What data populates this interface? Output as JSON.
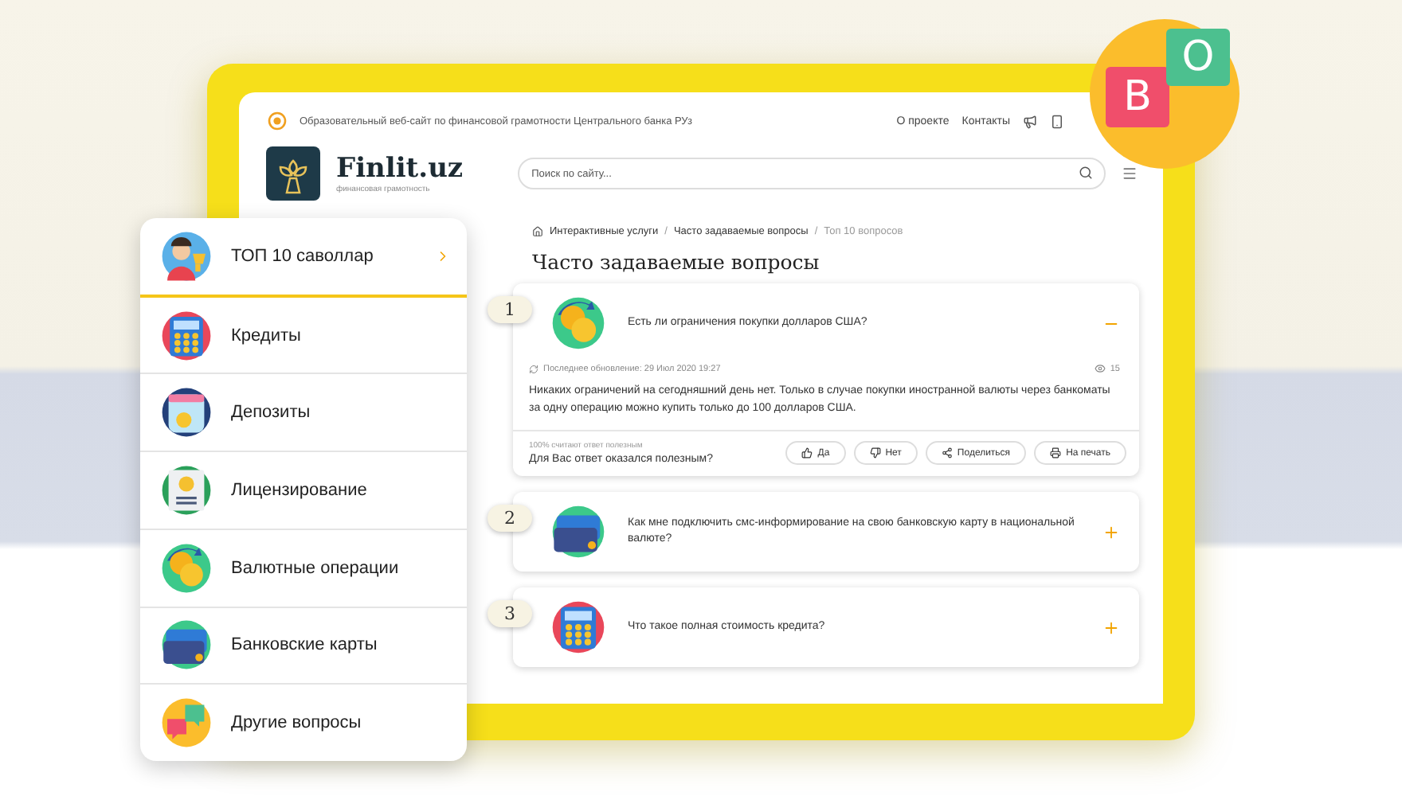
{
  "site_header": {
    "tagline": "Образовательный веб-сайт по финансовой грамотности Центрального банка РУз",
    "links": [
      "О проекте",
      "Контакты"
    ],
    "logo_name": "Finlit.uz",
    "logo_subtitle": "финансовая грамотность",
    "search": {
      "placeholder": "Поиск по сайту..."
    }
  },
  "breadcrumb_separator": "/",
  "breadcrumbs": [
    {
      "label": "Интерактивные услуги",
      "current": false
    },
    {
      "label": "Часто задаваемые вопросы",
      "current": false
    },
    {
      "label": "Топ 10 вопросов",
      "current": true
    }
  ],
  "page_title": "Часто задаваемые вопросы",
  "faq": [
    {
      "number": "1",
      "kind": "currency",
      "question": "Есть ли ограничения покупки долларов США?",
      "expanded": true,
      "updated": "Последнее обновление: 29 Июл 2020 19:27",
      "views": "15",
      "answer": "Никаких ограничений на сегодняшний день нет. Только в случае покупки иностранной валюты через банкоматы за одну операцию можно купить только до 100 долларов США.",
      "feedback_stat": "100% считают ответ полезным",
      "feedback_prompt": "Для Вас ответ оказался полезным?",
      "buttons": [
        {
          "kind": "like",
          "label": "Да"
        },
        {
          "kind": "dislike",
          "label": "Нет"
        },
        {
          "kind": "share",
          "label": "Поделиться"
        },
        {
          "kind": "print",
          "label": "На печать"
        }
      ]
    },
    {
      "number": "2",
      "kind": "card",
      "question": "Как мне подключить смс-информирование на свою банковскую карту в национальной валюте?",
      "expanded": false
    },
    {
      "number": "3",
      "kind": "calculator",
      "question": "Что такое полная стоимость кредита?",
      "expanded": false
    }
  ],
  "categories": [
    {
      "kind": "avatar",
      "label": "ТОП 10 саволлар",
      "selected": true
    },
    {
      "kind": "calculator",
      "label": "Кредиты",
      "selected": false
    },
    {
      "kind": "jar",
      "label": "Депозиты",
      "selected": false
    },
    {
      "kind": "certificate",
      "label": "Лицензирование",
      "selected": false
    },
    {
      "kind": "currency",
      "label": "Валютные операции",
      "selected": false
    },
    {
      "kind": "card",
      "label": "Банковские карты",
      "selected": false
    },
    {
      "kind": "chat",
      "label": "Другие вопросы",
      "selected": false
    }
  ],
  "badge": {
    "letters": [
      "B",
      "O"
    ]
  }
}
